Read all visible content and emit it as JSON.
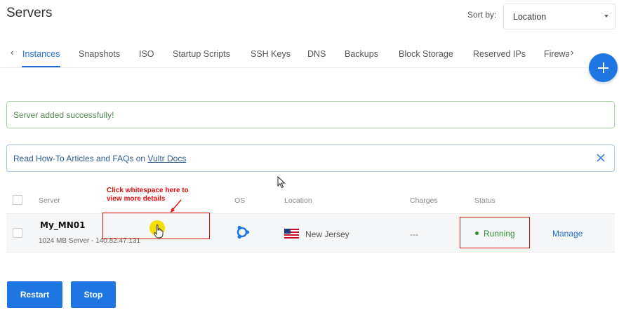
{
  "header": {
    "title": "Servers",
    "sort_label": "Sort by:",
    "sort_value": "Location"
  },
  "tabs": {
    "items": [
      {
        "label": "Instances",
        "active": true
      },
      {
        "label": "Snapshots"
      },
      {
        "label": "ISO"
      },
      {
        "label": "Startup Scripts"
      },
      {
        "label": "SSH Keys"
      },
      {
        "label": "DNS"
      },
      {
        "label": "Backups"
      },
      {
        "label": "Block Storage"
      },
      {
        "label": "Reserved IPs"
      },
      {
        "label": "Firewa"
      }
    ],
    "left_arrow": "‹",
    "right_arrow": "›"
  },
  "fab": {
    "label": "+"
  },
  "alerts": {
    "success": "Server added successfully!",
    "info_prefix": "Read How-To Articles and FAQs on ",
    "info_link": "Vultr Docs"
  },
  "table": {
    "headers": {
      "server": "Server",
      "os": "OS",
      "location": "Location",
      "charges": "Charges",
      "status": "Status"
    },
    "rows": [
      {
        "name": "My_MN01",
        "meta": "1024 MB Server - 140.82.47.131",
        "os_icon": "ubuntu-icon",
        "flag": "us-flag-icon",
        "location": "New Jersey",
        "charges": "---",
        "status": "Running",
        "action": "Manage"
      }
    ]
  },
  "annotation": {
    "line1": "Click whitespace here to",
    "line2": "view more details"
  },
  "actions": {
    "restart": "Restart",
    "stop": "Stop"
  },
  "colors": {
    "accent": "#1e76e3",
    "success_text": "#4f8a4f",
    "success_border": "#a8d4a6",
    "info_text": "#2f5d8f",
    "info_border": "#a9c7e8",
    "running": "#2f8f2f",
    "annotation_red": "#e01010"
  }
}
